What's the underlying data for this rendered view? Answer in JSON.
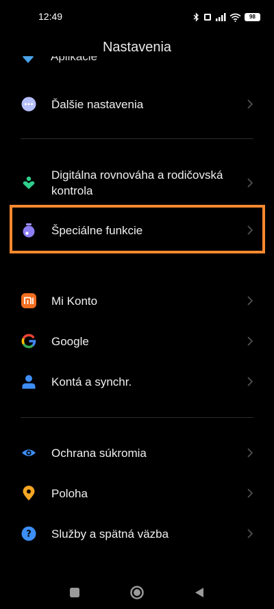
{
  "status_bar": {
    "time": "12:49",
    "battery": "98"
  },
  "header": {
    "title": "Nastavenia"
  },
  "partial_item": {
    "label": "Aplikácie"
  },
  "items": [
    {
      "label": "Ďalšie nastavenia"
    },
    {
      "label": "Digitálna rovnováha a rodičovská kontrola"
    },
    {
      "label": "Špeciálne funkcie"
    },
    {
      "label": "Mi Konto"
    },
    {
      "label": "Google"
    },
    {
      "label": "Kontá a synchr."
    },
    {
      "label": "Ochrana súkromia"
    },
    {
      "label": "Poloha"
    },
    {
      "label": "Služby a spätná väzba"
    }
  ],
  "colors": {
    "background": "#000000",
    "highlight": "#f7882f",
    "mi_orange": "#f36e20",
    "account_blue": "#3d8ef5"
  }
}
